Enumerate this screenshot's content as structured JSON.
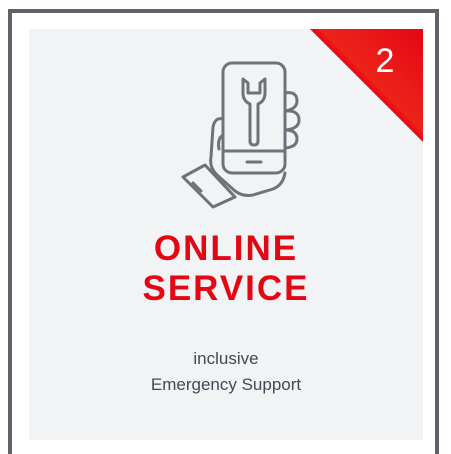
{
  "card": {
    "badge_number": "2",
    "title_line1": "ONLINE",
    "title_line2": "SERVICE",
    "subtitle_line1": "inclusive",
    "subtitle_line2": "Emergency Support",
    "icon": "hand-holding-phone-with-wrench-icon"
  },
  "colors": {
    "accent": "#e30613",
    "border": "#5d6369",
    "card_background": "#f2f3f5",
    "text": "#3f4a55",
    "icon_stroke": "#6d737a"
  }
}
